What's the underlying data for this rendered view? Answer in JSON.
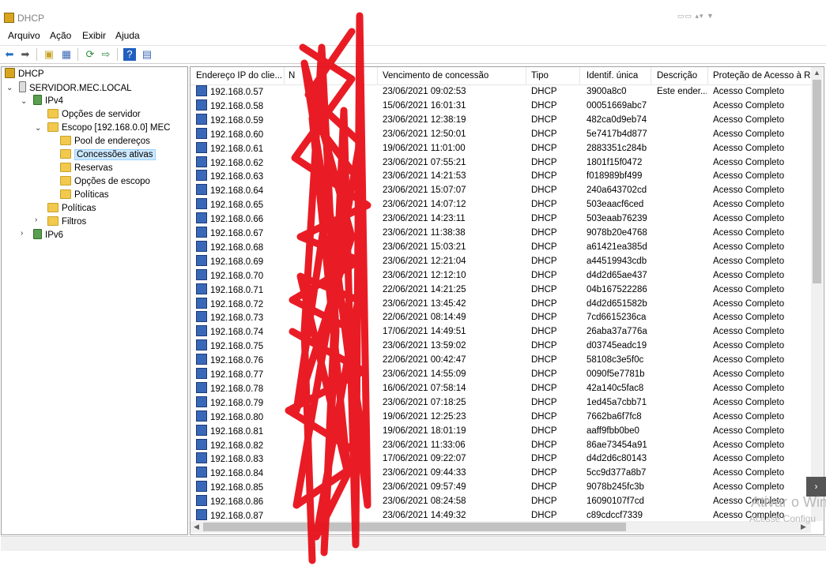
{
  "window": {
    "title": "DHCP"
  },
  "menu": [
    "Arquivo",
    "Ação",
    "Exibir",
    "Ajuda"
  ],
  "toolbar": {
    "icons": [
      "back-icon",
      "forward-icon",
      "up-icon",
      "show-hide-tree-icon",
      "refresh-icon",
      "export-icon",
      "help-icon",
      "properties-icon"
    ]
  },
  "tree": [
    {
      "label": "DHCP",
      "icon": "dhcp-icon"
    },
    {
      "label": "SERVIDOR.MEC.LOCAL",
      "icon": "server-icon",
      "expanded": true
    },
    {
      "label": "IPv4",
      "icon": "network-icon",
      "expanded": true
    },
    {
      "label": "Opções de servidor",
      "icon": "folder-icon"
    },
    {
      "label": "Escopo [192.168.0.0] MEC",
      "icon": "folder-icon",
      "expanded": true
    },
    {
      "label": "Pool de endereços",
      "icon": "folder-icon"
    },
    {
      "label": "Concessões ativas",
      "icon": "folder-icon",
      "selected": true
    },
    {
      "label": "Reservas",
      "icon": "folder-icon"
    },
    {
      "label": "Opções de escopo",
      "icon": "folder-icon"
    },
    {
      "label": "Políticas",
      "icon": "folder-icon"
    },
    {
      "label": "Políticas",
      "icon": "folder-icon"
    },
    {
      "label": "Filtros",
      "icon": "folder-icon",
      "expanded": false
    },
    {
      "label": "IPv6",
      "icon": "network-icon",
      "expanded": false
    }
  ],
  "columns": [
    "Endereço IP do clie...",
    "N",
    "Vencimento de concessão",
    "Tipo",
    "Identif. única",
    "Descrição",
    "Proteção de Acesso à Re"
  ],
  "rows": [
    [
      "192.168.0.57",
      "",
      "23/06/2021 09:02:53",
      "DHCP",
      "3900a8c0",
      "Este ender...",
      "Acesso Completo"
    ],
    [
      "192.168.0.58",
      "",
      "15/06/2021 16:01:31",
      "DHCP",
      "00051669abc7",
      "",
      "Acesso Completo"
    ],
    [
      "192.168.0.59",
      "",
      "23/06/2021 12:38:19",
      "DHCP",
      "482ca0d9eb74",
      "",
      "Acesso Completo"
    ],
    [
      "192.168.0.60",
      "",
      "23/06/2021 12:50:01",
      "DHCP",
      "5e7417b4d877",
      "",
      "Acesso Completo"
    ],
    [
      "192.168.0.61",
      "",
      "19/06/2021 11:01:00",
      "DHCP",
      "2883351c284b",
      "",
      "Acesso Completo"
    ],
    [
      "192.168.0.62",
      "",
      "23/06/2021 07:55:21",
      "DHCP",
      "1801f15f0472",
      "",
      "Acesso Completo"
    ],
    [
      "192.168.0.63",
      "",
      "23/06/2021 14:21:53",
      "DHCP",
      "f018989bf499",
      "",
      "Acesso Completo"
    ],
    [
      "192.168.0.64",
      "",
      "23/06/2021 15:07:07",
      "DHCP",
      "240a643702cd",
      "",
      "Acesso Completo"
    ],
    [
      "192.168.0.65",
      "",
      "23/06/2021 14:07:12",
      "DHCP",
      "503eaacf6ced",
      "",
      "Acesso Completo"
    ],
    [
      "192.168.0.66",
      "",
      "23/06/2021 14:23:11",
      "DHCP",
      "503eaab76239",
      "",
      "Acesso Completo"
    ],
    [
      "192.168.0.67",
      "",
      "23/06/2021 11:38:38",
      "DHCP",
      "9078b20e4768",
      "",
      "Acesso Completo"
    ],
    [
      "192.168.0.68",
      "",
      "23/06/2021 15:03:21",
      "DHCP",
      "a61421ea385d",
      "",
      "Acesso Completo"
    ],
    [
      "192.168.0.69",
      "",
      "23/06/2021 12:21:04",
      "DHCP",
      "a44519943cdb",
      "",
      "Acesso Completo"
    ],
    [
      "192.168.0.70",
      "",
      "23/06/2021 12:12:10",
      "DHCP",
      "d4d2d65ae437",
      "",
      "Acesso Completo"
    ],
    [
      "192.168.0.71",
      "",
      "22/06/2021 14:21:25",
      "DHCP",
      "04b167522286",
      "",
      "Acesso Completo"
    ],
    [
      "192.168.0.72",
      "",
      "23/06/2021 13:45:42",
      "DHCP",
      "d4d2d651582b",
      "",
      "Acesso Completo"
    ],
    [
      "192.168.0.73",
      "",
      "22/06/2021 08:14:49",
      "DHCP",
      "7cd6615236ca",
      "",
      "Acesso Completo"
    ],
    [
      "192.168.0.74",
      "",
      "17/06/2021 14:49:51",
      "DHCP",
      "26aba37a776a",
      "",
      "Acesso Completo"
    ],
    [
      "192.168.0.75",
      "",
      "23/06/2021 13:59:02",
      "DHCP",
      "d03745eadc19",
      "",
      "Acesso Completo"
    ],
    [
      "192.168.0.76",
      "",
      "22/06/2021 00:42:47",
      "DHCP",
      "58108c3e5f0c",
      "",
      "Acesso Completo"
    ],
    [
      "192.168.0.77",
      "",
      "23/06/2021 14:55:09",
      "DHCP",
      "0090f5e7781b",
      "",
      "Acesso Completo"
    ],
    [
      "192.168.0.78",
      "",
      "16/06/2021 07:58:14",
      "DHCP",
      "42a140c5fac8",
      "",
      "Acesso Completo"
    ],
    [
      "192.168.0.79",
      "",
      "23/06/2021 07:18:25",
      "DHCP",
      "1ed45a7cbb71",
      "",
      "Acesso Completo"
    ],
    [
      "192.168.0.80",
      "",
      "19/06/2021 12:25:23",
      "DHCP",
      "7662ba6f7fc8",
      "",
      "Acesso Completo"
    ],
    [
      "192.168.0.81",
      "",
      "19/06/2021 18:01:19",
      "DHCP",
      "aaff9fbb0be0",
      "",
      "Acesso Completo"
    ],
    [
      "192.168.0.82",
      "",
      "23/06/2021 11:33:06",
      "DHCP",
      "86ae73454a91",
      "",
      "Acesso Completo"
    ],
    [
      "192.168.0.83",
      "",
      "17/06/2021 09:22:07",
      "DHCP",
      "d4d2d6c80143",
      "",
      "Acesso Completo"
    ],
    [
      "192.168.0.84",
      "",
      "23/06/2021 09:44:33",
      "DHCP",
      "5cc9d377a8b7",
      "",
      "Acesso Completo"
    ],
    [
      "192.168.0.85",
      "",
      "23/06/2021 09:57:49",
      "DHCP",
      "9078b245fc3b",
      "",
      "Acesso Completo"
    ],
    [
      "192.168.0.86",
      "",
      "23/06/2021 08:24:58",
      "DHCP",
      "16090107f7cd",
      "",
      "Acesso Completo"
    ],
    [
      "192.168.0.87",
      "",
      "23/06/2021 14:49:32",
      "DHCP",
      "c89cdccf7339",
      "",
      "Acesso Completo"
    ]
  ],
  "watermark": {
    "line1": "Ativar o Win",
    "line2": "Acesse Configu"
  },
  "colors": {
    "selection": "#cce8ff",
    "redaction": "#e8101a",
    "watermark": "#b9b9b9"
  }
}
